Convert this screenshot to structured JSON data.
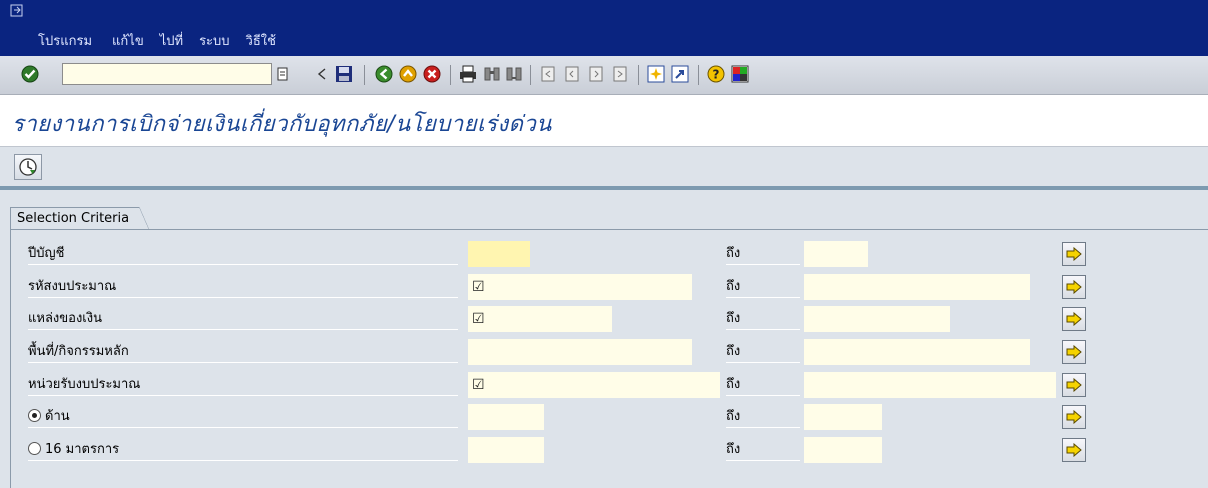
{
  "menu": {
    "items": [
      "โปรแกรม",
      "แก้ไข",
      "ไปที่",
      "ระบบ",
      "วิธีใช้"
    ]
  },
  "toolbar": {
    "command_value": "",
    "icons": [
      "enter-icon",
      "save-icon",
      "back-icon",
      "exit-icon",
      "cancel-icon",
      "print-icon",
      "find-icon",
      "find-next-icon",
      "first-page-icon",
      "previous-page-icon",
      "next-page-icon",
      "last-page-icon",
      "create-session-icon",
      "shortcut-icon",
      "help-icon",
      "layout-menu-icon"
    ]
  },
  "page": {
    "title": "รายงานการเบิกจ่ายเงินเกี่ยวกับอุทกภัย/นโยบายเร่งด่วน"
  },
  "selection": {
    "group_title": "Selection Criteria",
    "to_label": "ถึง",
    "rows": [
      {
        "label": "ปีบัญชี",
        "from": "",
        "to": ""
      },
      {
        "label": "รหัสงบประมาณ",
        "from": "☑",
        "to": ""
      },
      {
        "label": "แหล่งของเงิน",
        "from": "☑",
        "to": ""
      },
      {
        "label": "พื้นที่/กิจกรรมหลัก",
        "from": "",
        "to": ""
      },
      {
        "label": "หน่วยรับงบประมาณ",
        "from": "☑",
        "to": ""
      },
      {
        "label": "ด้าน",
        "from": "",
        "to": "",
        "radio": "selected"
      },
      {
        "label": "16 มาตรการ",
        "from": "",
        "to": "",
        "radio": "unselected"
      }
    ]
  },
  "colors": {
    "titlebar": "#0a2480",
    "title_text": "#1a4694",
    "panel": "#dde3ea",
    "input": "#fffde8",
    "required_input": "#fff5b0"
  }
}
